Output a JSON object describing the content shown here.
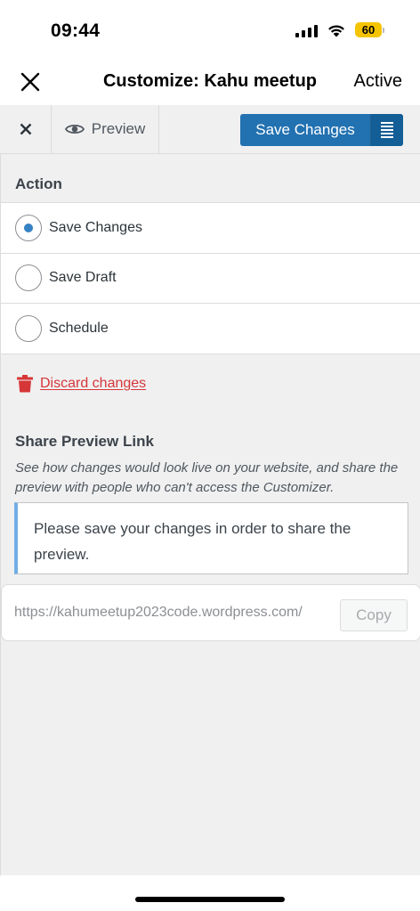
{
  "status_bar": {
    "time": "09:44",
    "battery_level": "60",
    "battery_color": "#f5c400",
    "signal_icon": "cellular-signal-icon",
    "wifi_icon": "wifi-icon"
  },
  "nav": {
    "close_icon": "close-icon",
    "title": "Customize: Kahu meetup",
    "status": "Active"
  },
  "customizer_header": {
    "close_icon": "close-icon",
    "preview_icon": "eye-icon",
    "preview_label": "Preview",
    "save_label": "Save Changes",
    "save_menu_icon": "menu-lines-icon",
    "accent_color": "#2271b1"
  },
  "action": {
    "title": "Action",
    "selected": "Save Changes",
    "options": [
      {
        "label": "Save Changes",
        "checked": true
      },
      {
        "label": "Save Draft",
        "checked": false
      },
      {
        "label": "Schedule",
        "checked": false
      }
    ]
  },
  "discard": {
    "icon": "trash-icon",
    "label": "Discard changes",
    "color": "#d63638"
  },
  "share": {
    "title": "Share Preview Link",
    "description": "See how changes would look live on your website, and share the preview with people who can't access the Customizer.",
    "notice": "Please save your changes in order to share the preview.",
    "url": "https://kahumeetup2023code.wordpress.com/",
    "copy_label": "Copy"
  }
}
